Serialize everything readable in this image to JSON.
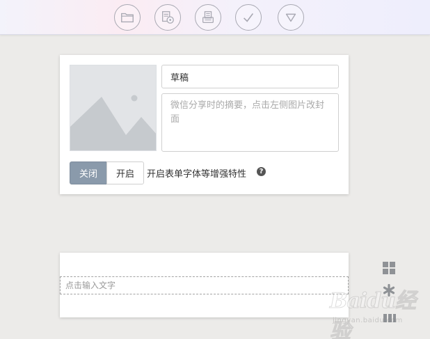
{
  "toolbar": {
    "buttons": [
      {
        "icon": "folder-icon"
      },
      {
        "icon": "media-library-icon"
      },
      {
        "icon": "print-icon"
      },
      {
        "icon": "check-icon"
      },
      {
        "icon": "triangle-down-icon"
      }
    ]
  },
  "editor": {
    "cover_icon": "image-placeholder-icon",
    "title_value": "草稿",
    "summary_placeholder": "微信分享时的摘要，点击左侧图片改封面",
    "toggle": {
      "off_label": "关闭",
      "on_label": "开启",
      "selected": "关闭",
      "description": "开启表单字体等增强特性"
    },
    "help_icon_glyph": "?"
  },
  "text_block": {
    "placeholder": "点击输入文字"
  },
  "side_icons": [
    "grid-icon",
    "asterisk-icon",
    "bar-icon"
  ],
  "watermark": {
    "text": "Baidu经验",
    "sub": "jingyan.baidu.com"
  },
  "colors": {
    "accent_off": "#8a9aab",
    "page_background": "#ecebe9"
  }
}
